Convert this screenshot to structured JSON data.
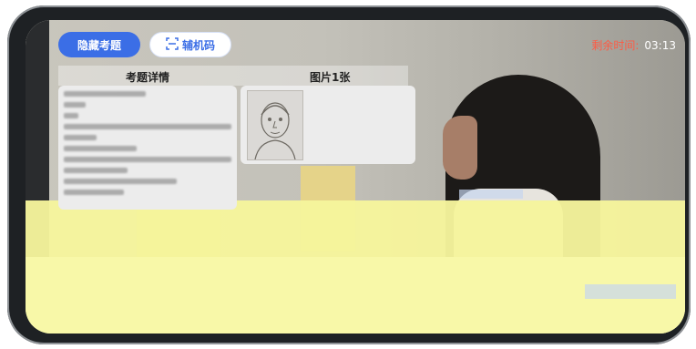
{
  "toolbar": {
    "hide_label": "隐藏考题",
    "code_label": "辅机码"
  },
  "timer": {
    "label": "剩余时间:",
    "value": "03:13"
  },
  "panels": {
    "question_title": "考题详情",
    "image_title": "图片1张"
  },
  "colors": {
    "accent": "#3b6ee6",
    "timer_label": "#ff5a43"
  }
}
